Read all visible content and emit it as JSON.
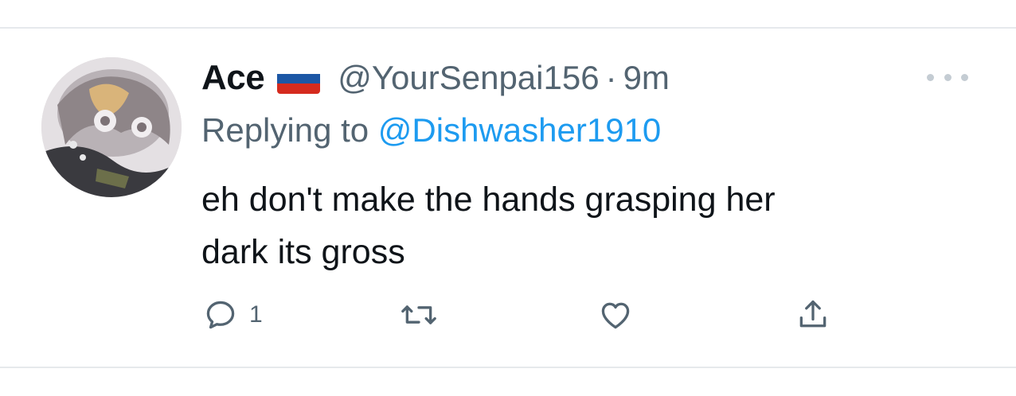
{
  "tweet": {
    "author": {
      "display_name": "Ace",
      "handle": "@YourSenpai156",
      "flag_icon": "russia-flag-icon"
    },
    "separator": "·",
    "time": "9m",
    "replying_to_label": "Replying to",
    "replying_to_handle": "@Dishwasher1910",
    "text_line1": "eh don't make the hands grasping her",
    "text_line2": "dark its gross",
    "actions": {
      "reply_icon": "reply-icon",
      "reply_count": "1",
      "retweet_icon": "retweet-icon",
      "like_icon": "heart-icon",
      "share_icon": "share-icon"
    }
  },
  "colors": {
    "text_primary": "#0f1419",
    "text_secondary": "#536471",
    "link": "#1d9bf0",
    "divider": "#e6e9ec",
    "flag_white": "#ffffff",
    "flag_blue": "#1c57a5",
    "flag_red": "#d52b1e"
  }
}
